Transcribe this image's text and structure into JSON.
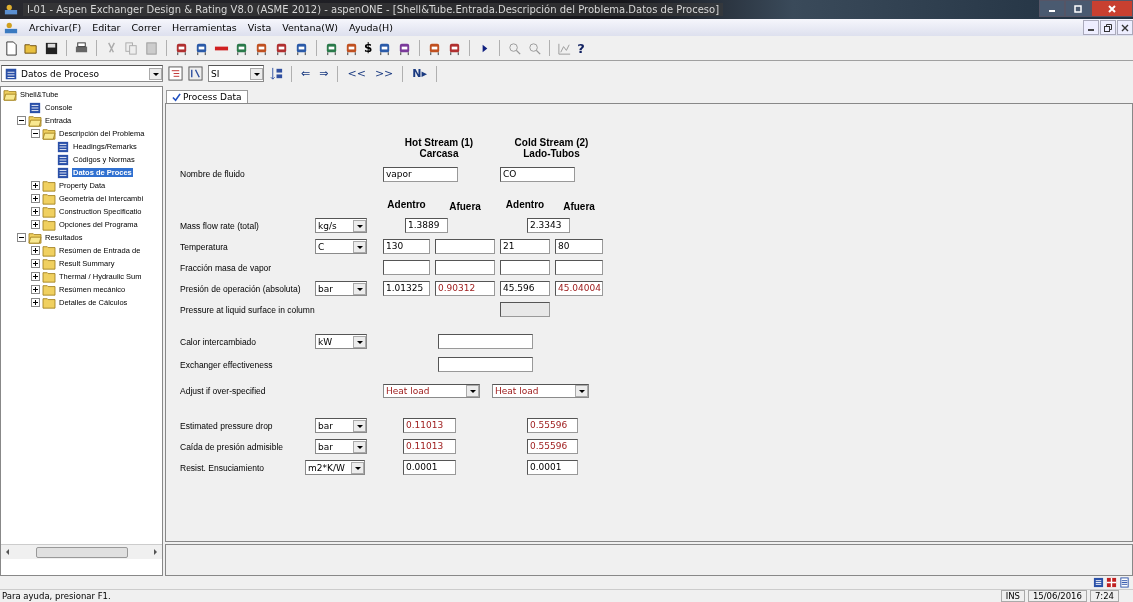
{
  "window": {
    "title": "I-01 - Aspen Exchanger Design & Rating V8.0 (ASME 2012) - aspenONE - [Shell&Tube.Entrada.Descripción del Problema.Datos de Proceso]"
  },
  "menu": [
    "Archivar(F)",
    "Editar",
    "Correr",
    "Herramientas",
    "Vista",
    "Ventana(W)",
    "Ayuda(H)"
  ],
  "toolbar": {
    "cost_glyph": "$",
    "help_glyph": "?"
  },
  "navbar": {
    "form_select": "Datos de Proceso",
    "units_select": "SI",
    "back": "⇐",
    "forward": "⇒",
    "first": "<<",
    "last": ">>",
    "next": "N▸"
  },
  "tree": [
    {
      "label": "Shell&Tube",
      "kind": "folder",
      "expanded": true,
      "selected": false,
      "children": [
        {
          "label": "Console",
          "kind": "page",
          "selected": false
        },
        {
          "label": "Entrada",
          "kind": "folder",
          "expanded": true,
          "selected": false,
          "children": [
            {
              "label": "Descripción del Problema",
              "kind": "folder",
              "expanded": true,
              "selected": false,
              "children": [
                {
                  "label": "Headings/Remarks",
                  "kind": "page",
                  "selected": false
                },
                {
                  "label": "Códigos y Normas",
                  "kind": "page",
                  "selected": false
                },
                {
                  "label": "Datos de Proces",
                  "kind": "page",
                  "selected": true
                }
              ]
            },
            {
              "label": "Property Data",
              "kind": "folder",
              "expanded": false,
              "selected": false
            },
            {
              "label": "Geometria del Intercambi",
              "kind": "folder",
              "expanded": false,
              "selected": false
            },
            {
              "label": "Construction Specificatio",
              "kind": "folder",
              "expanded": false,
              "selected": false
            },
            {
              "label": "Opciones del Programa",
              "kind": "folder",
              "expanded": false,
              "selected": false
            }
          ]
        },
        {
          "label": "Resultados",
          "kind": "folder",
          "expanded": true,
          "selected": false,
          "children": [
            {
              "label": "Resúmen de Entrada de",
              "kind": "folder",
              "expanded": false,
              "selected": false
            },
            {
              "label": "Result Summary",
              "kind": "folder",
              "expanded": false,
              "selected": false
            },
            {
              "label": "Thermal / Hydraulic Sum",
              "kind": "folder",
              "expanded": false,
              "selected": false
            },
            {
              "label": "Resúmen mecánico",
              "kind": "folder",
              "expanded": false,
              "selected": false
            },
            {
              "label": "Detalles de Cálculos",
              "kind": "folder",
              "expanded": false,
              "selected": false
            }
          ]
        }
      ]
    }
  ],
  "tabs": [
    {
      "label": "Process Data",
      "selected": true
    }
  ],
  "streams": [
    {
      "title": "Hot Stream (1)",
      "side": "Carcasa"
    },
    {
      "title": "Cold Stream (2)",
      "side": "Lado-Tubos"
    }
  ],
  "column_headers": [
    "Adentro",
    "Afuera",
    "Adentro",
    "Afuera"
  ],
  "rows": [
    {
      "kind": "name",
      "label": "Nombre de fluido",
      "fields": [
        {
          "value": "vapor",
          "calculated": false
        },
        {
          "value": "CO",
          "calculated": false
        }
      ]
    },
    {
      "kind": "headers"
    },
    {
      "kind": "flow",
      "label": "Mass flow rate (total)",
      "unit": "kg/s",
      "fields": [
        {
          "value": "1.3889",
          "calculated": false
        },
        {
          "value": "2.3343",
          "calculated": false
        }
      ]
    },
    {
      "kind": "quad",
      "label": "Temperatura",
      "unit": "C",
      "fields": [
        {
          "value": "130",
          "calculated": false
        },
        {
          "disabled": false
        },
        {
          "value": "21",
          "calculated": false
        },
        {
          "value": "80",
          "calculated": false
        }
      ]
    },
    {
      "kind": "quad",
      "label": "Fracción masa de vapor",
      "fields": [
        {
          "disabled": false
        },
        {
          "disabled": false
        },
        {
          "disabled": false
        },
        {
          "disabled": false
        }
      ]
    },
    {
      "kind": "quad",
      "label": "Presión de operación (absoluta)",
      "unit": "bar",
      "fields": [
        {
          "value": "1.01325",
          "calculated": false
        },
        {
          "value": "0.90312",
          "calculated": true
        },
        {
          "value": "45.596",
          "calculated": false
        },
        {
          "value": "45.04004",
          "calculated": true
        }
      ]
    },
    {
      "kind": "liquid",
      "label": "Pressure at liquid surface in column",
      "field": {
        "disabled": true
      }
    },
    {
      "kind": "wide",
      "label": "Calor intercambiado",
      "unit": "kW",
      "field": {
        "disabled": false
      }
    },
    {
      "kind": "wide",
      "label": "Exchanger effectiveness",
      "field": {
        "disabled": false
      }
    },
    {
      "kind": "select",
      "label": "Adjust if over-specified",
      "fields": [
        {
          "value": "Heat load",
          "calculated": true
        },
        {
          "value": "Heat load",
          "calculated": true
        }
      ]
    },
    {
      "kind": "pair",
      "label": "Estimated pressure drop",
      "unit": "bar",
      "fields": [
        {
          "value": "0.11013",
          "calculated": true
        },
        {
          "value": "0.55596",
          "calculated": true
        }
      ]
    },
    {
      "kind": "pair",
      "label": "Caída de presión admisible",
      "unit": "bar",
      "fields": [
        {
          "value": "0.11013",
          "calculated": true
        },
        {
          "value": "0.55596",
          "calculated": true
        }
      ]
    },
    {
      "kind": "pair",
      "label": "Resist. Ensuciamiento",
      "unit": "m2*K/W",
      "fields": [
        {
          "value": "0.0001",
          "calculated": false
        },
        {
          "value": "0.0001",
          "calculated": false
        }
      ]
    }
  ],
  "status_bar": {
    "help": "Para ayuda, presionar F1.",
    "mode": "INS",
    "date": "15/06/2016",
    "time": "7:24"
  }
}
